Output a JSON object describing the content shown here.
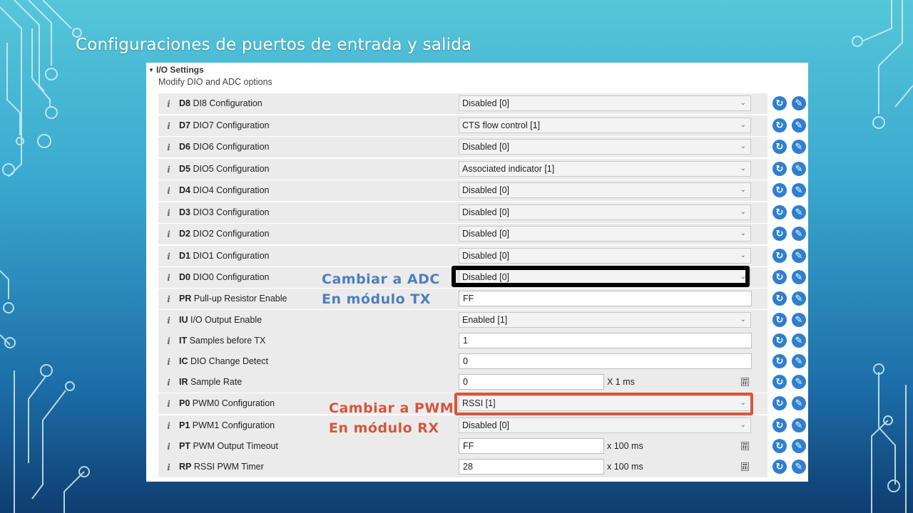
{
  "slide": {
    "title": "Configuraciones de puertos de entrada y salida"
  },
  "panel": {
    "header": "I/O Settings",
    "subtitle": "Modify DIO and ADC options"
  },
  "rows": [
    {
      "code": "D8",
      "name": "DI8 Configuration",
      "type": "select",
      "value": "Disabled [0]"
    },
    {
      "code": "D7",
      "name": "DIO7 Configuration",
      "type": "select",
      "value": "CTS flow control [1]"
    },
    {
      "code": "D6",
      "name": "DIO6 Configuration",
      "type": "select",
      "value": "Disabled [0]"
    },
    {
      "code": "D5",
      "name": "DIO5 Configuration",
      "type": "select",
      "value": "Associated indicator [1]"
    },
    {
      "code": "D4",
      "name": "DIO4 Configuration",
      "type": "select",
      "value": "Disabled [0]"
    },
    {
      "code": "D3",
      "name": "DIO3 Configuration",
      "type": "select",
      "value": "Disabled [0]"
    },
    {
      "code": "D2",
      "name": "DIO2 Configuration",
      "type": "select",
      "value": "Disabled [0]"
    },
    {
      "code": "D1",
      "name": "DIO1 Configuration",
      "type": "select",
      "value": "Disabled [0]"
    },
    {
      "code": "D0",
      "name": "DIO0 Configuration",
      "type": "select",
      "value": "Disabled [0]"
    },
    {
      "code": "PR",
      "name": "Pull-up Resistor Enable",
      "type": "text",
      "value": "FF"
    },
    {
      "code": "IU",
      "name": "I/O Output Enable",
      "type": "select",
      "value": "Enabled [1]"
    },
    {
      "code": "IT",
      "name": "Samples before TX",
      "type": "text",
      "value": "1"
    },
    {
      "code": "IC",
      "name": "DIO Change Detect",
      "type": "text",
      "value": "0"
    },
    {
      "code": "IR",
      "name": "Sample Rate",
      "type": "text-unit",
      "value": "0",
      "unit": "X 1 ms"
    },
    {
      "code": "P0",
      "name": "PWM0 Configuration",
      "type": "select",
      "value": "RSSI [1]"
    },
    {
      "code": "P1",
      "name": "PWM1 Configuration",
      "type": "select",
      "value": "Disabled [0]"
    },
    {
      "code": "PT",
      "name": "PWM Output Timeout",
      "type": "text-unit",
      "value": "FF",
      "unit": "x 100 ms"
    },
    {
      "code": "RP",
      "name": "RSSI PWM Timer",
      "type": "text-unit",
      "value": "28",
      "unit": "x 100 ms"
    }
  ],
  "annotations": {
    "adc": {
      "line1": "Cambiar a ADC",
      "line2": "En módulo TX",
      "color": "#4d7fbf"
    },
    "pwm": {
      "line1": "Cambiar a PWM",
      "line2": "En módulo RX",
      "color": "#d6553c"
    }
  },
  "icons": {
    "info": "info-icon",
    "chevron": "chevron-down-icon",
    "refresh": "refresh-icon",
    "write": "pencil-icon",
    "calculator": "calculator-icon"
  },
  "colors": {
    "button_blue": "#2f7fcf",
    "highlight_black": "#000000",
    "highlight_red": "#d6553c"
  }
}
